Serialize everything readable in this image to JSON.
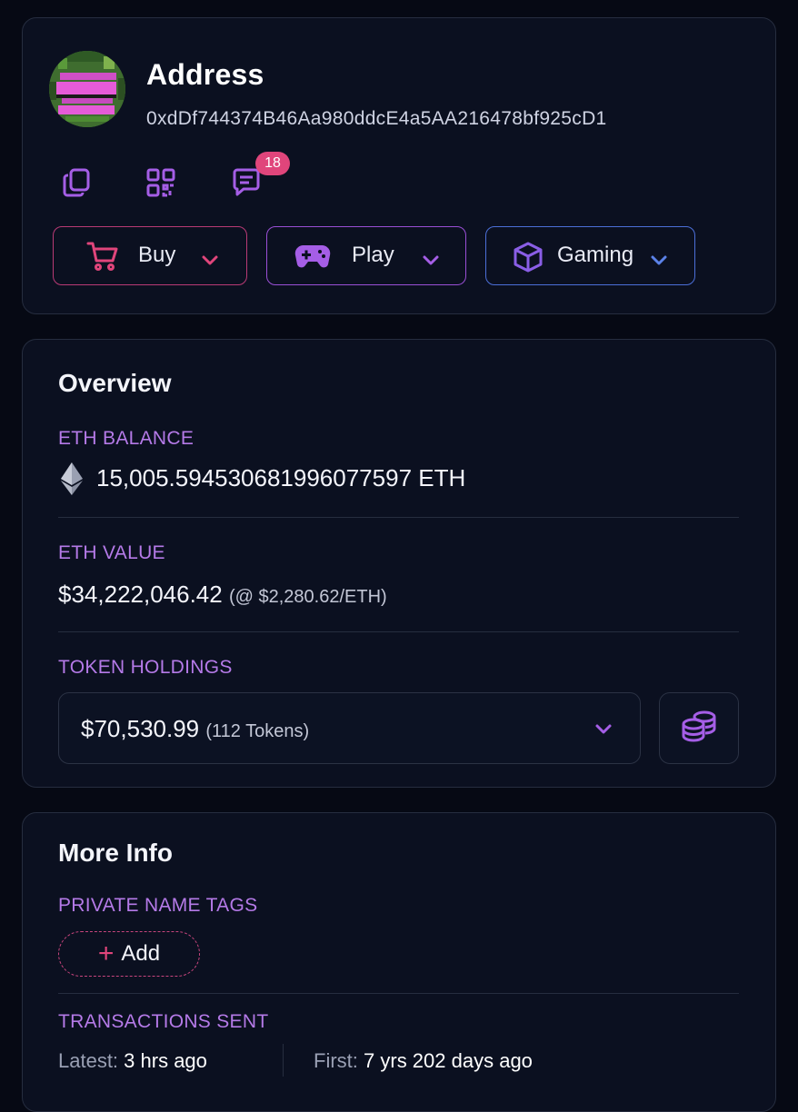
{
  "address_card": {
    "title": "Address",
    "hash": "0xdDf744374B46Aa980ddcE4a5AA216478bf925cD1",
    "icons": {
      "copy": "copy-icon",
      "qr": "qr-code-icon",
      "comments": "comment-icon"
    },
    "comment_count": "18",
    "buttons": [
      {
        "label": "Buy",
        "icon": "cart-icon",
        "color": "#b93a75"
      },
      {
        "label": "Play",
        "icon": "gamepad-icon",
        "color": "#9a4fd6"
      },
      {
        "label": "Gaming",
        "icon": "cube-icon",
        "color": "#4c6fd8"
      }
    ]
  },
  "overview": {
    "title": "Overview",
    "eth_balance_label": "ETH BALANCE",
    "eth_balance_value": "15,005.59453068199607759​7 ETH",
    "eth_value_label": "ETH VALUE",
    "eth_value": "$34,222,046.42",
    "eth_price_note": "(@ $2,280.62/ETH)",
    "token_holdings_label": "TOKEN HOLDINGS",
    "token_holdings_value": "$70,530.99",
    "token_count": "(112 Tokens)"
  },
  "more_info": {
    "title": "More Info",
    "private_tags_label": "PRIVATE NAME TAGS",
    "add_label": "Add",
    "tx_sent_label": "TRANSACTIONS SENT",
    "latest_label": "Latest:",
    "latest_value": "3 hrs ago",
    "first_label": "First:",
    "first_value": "7 yrs 202 days ago"
  },
  "colors": {
    "background": "#060914",
    "card": "#0b1020",
    "accent_label": "#b57ae8",
    "badge": "#e0457b"
  }
}
